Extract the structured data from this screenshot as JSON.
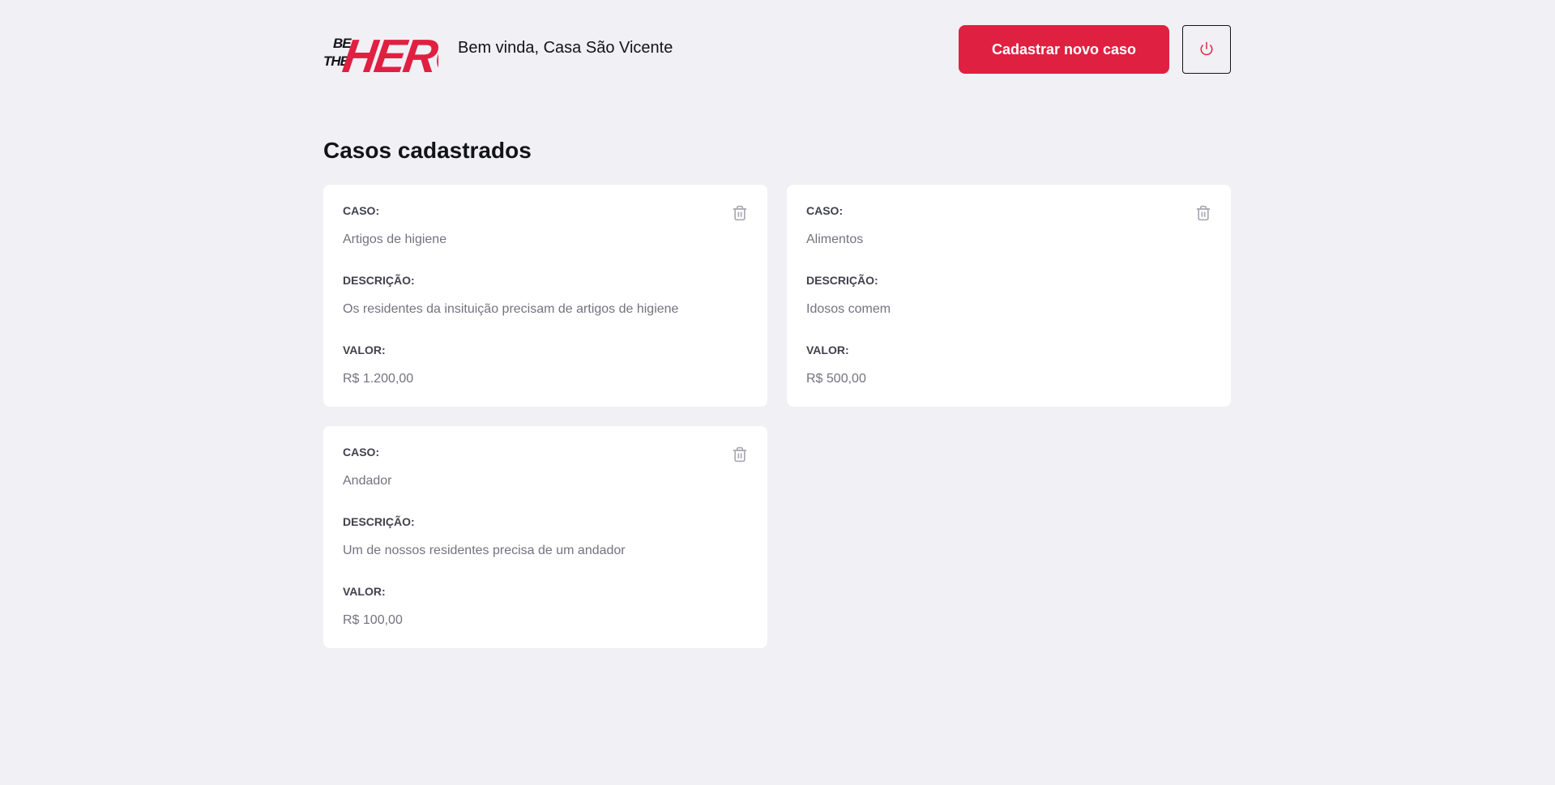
{
  "header": {
    "logo_text": "BE THE HERO",
    "welcome": "Bem vinda, Casa São Vicente",
    "new_case_label": "Cadastrar novo caso",
    "logout_icon": "power-icon"
  },
  "main": {
    "title": "Casos cadastrados",
    "cases": [
      {
        "case_label": "CASO:",
        "case_value": "Artigos de higiene",
        "description_label": "DESCRIÇÃO:",
        "description_value": "Os residentes da insituição precisam de artigos de higiene",
        "value_label": "VALOR:",
        "value_value": "R$ 1.200,00"
      },
      {
        "case_label": "CASO:",
        "case_value": "Alimentos",
        "description_label": "DESCRIÇÃO:",
        "description_value": "Idosos comem",
        "value_label": "VALOR:",
        "value_value": "R$ 500,00"
      },
      {
        "case_label": "CASO:",
        "case_value": "Andador",
        "description_label": "DESCRIÇÃO:",
        "description_value": "Um de nossos residentes precisa de um andador",
        "value_label": "VALOR:",
        "value_value": "R$ 100,00"
      }
    ],
    "delete_icon": "trash-icon"
  },
  "colors": {
    "background": "#f0f0f5",
    "accent": "#e02041",
    "card": "#ffffff",
    "text_dark": "#13131a",
    "label": "#41414d",
    "muted": "#737380"
  }
}
